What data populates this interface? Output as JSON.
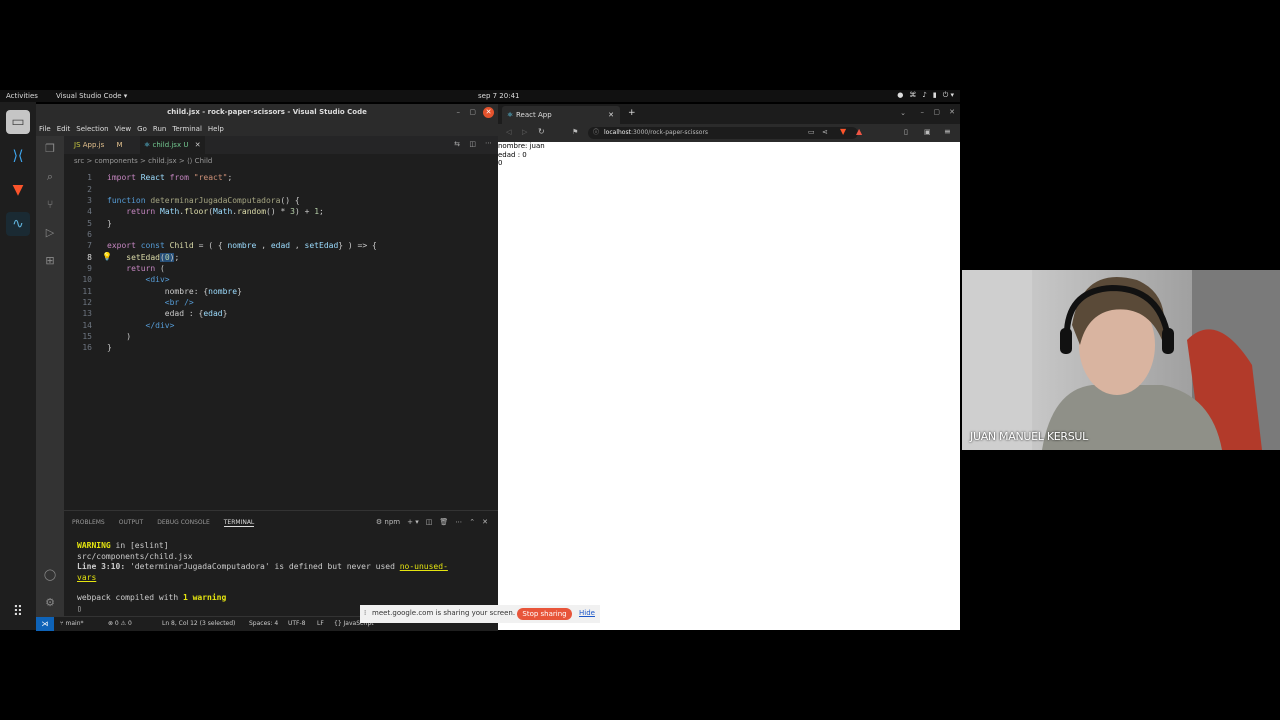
{
  "topbar": {
    "activities": "Activities",
    "app": "Visual Studio Code ▾",
    "clock": "sep 7  20:41"
  },
  "vscode": {
    "title": "child.jsx - rock-paper-scissors - Visual Studio Code",
    "menu": [
      "File",
      "Edit",
      "Selection",
      "View",
      "Go",
      "Run",
      "Terminal",
      "Help"
    ],
    "tabs": [
      {
        "label": "App.js",
        "badge": "M"
      },
      {
        "label": "child.jsx",
        "badge": "U"
      }
    ],
    "breadcrumb": "src  >  components  >  child.jsx  >  ⟨⟩ Child",
    "panel_tabs": [
      "PROBLEMS",
      "OUTPUT",
      "DEBUG CONSOLE",
      "TERMINAL"
    ],
    "terminal_shell": "npm",
    "terminal": {
      "l1a": "WARNING",
      "l1b": " in [eslint]",
      "l2": "src/components/child.jsx",
      "l3a": "  Line 3:10:",
      "l3b": "  'determinarJugadaComputadora' is defined but never used  ",
      "l3c": "no-unused-",
      "l4": "vars",
      "l5a": "webpack compiled with ",
      "l5b": "1 warning"
    },
    "status": {
      "branch": "main*",
      "errors": "⊗ 0 ⚠ 0",
      "position": "Ln 8, Col 12 (3 selected)",
      "spaces": "Spaces: 4",
      "encoding": "UTF-8",
      "eol": "LF",
      "lang": "{} JavaScript"
    }
  },
  "browser": {
    "tab_title": "React App",
    "url_host": "localhost",
    "url_path": ":3000/rock-paper-scissors",
    "page_lines": [
      "nombre: juan",
      "edad : 0",
      "0"
    ]
  },
  "webcam": {
    "name": "JUAN MANUEL KERSUL"
  },
  "meet_bar": {
    "text": "meet.google.com is sharing your screen.",
    "stop": "Stop sharing",
    "hide": "Hide"
  }
}
